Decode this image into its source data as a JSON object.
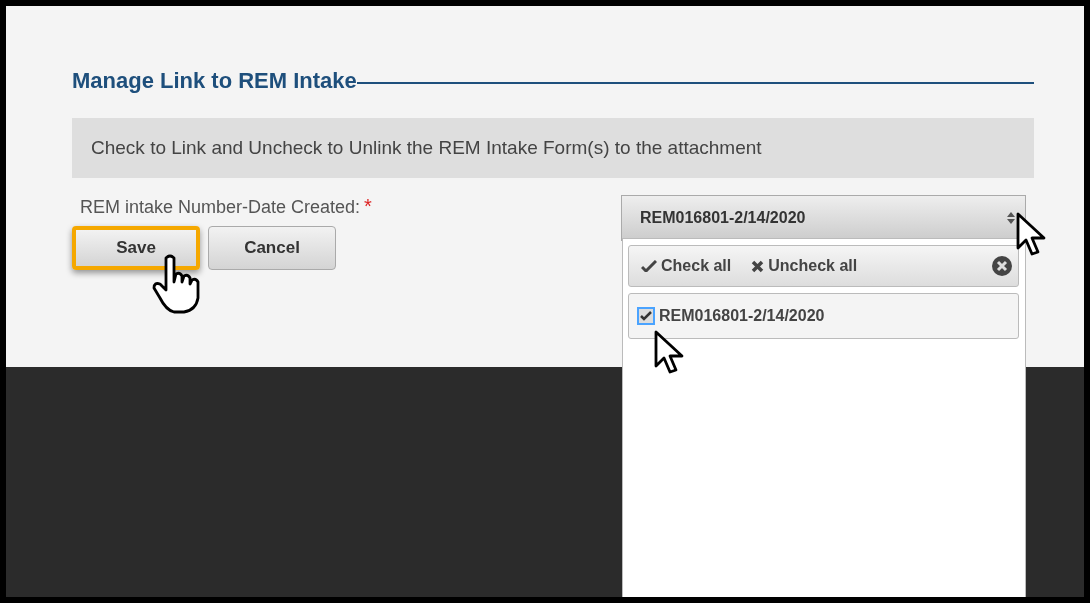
{
  "dialog": {
    "title": "Manage Link to REM Intake",
    "instructions": "Check to Link and Uncheck to Unlink the REM Intake Form(s) to the attachment",
    "field": {
      "label": "REM intake Number-Date Created:",
      "required_mark": "*",
      "select_value": "REM016801-2/14/2020",
      "open": true
    },
    "buttons": [
      {
        "label": "Save",
        "focused": true
      },
      {
        "label": "Cancel",
        "focused": false
      }
    ]
  },
  "dropdown": {
    "check_all": "Check all",
    "uncheck_all": "Uncheck all",
    "options": [
      {
        "label": "REM016801-2/14/2020",
        "checked": true
      }
    ]
  }
}
